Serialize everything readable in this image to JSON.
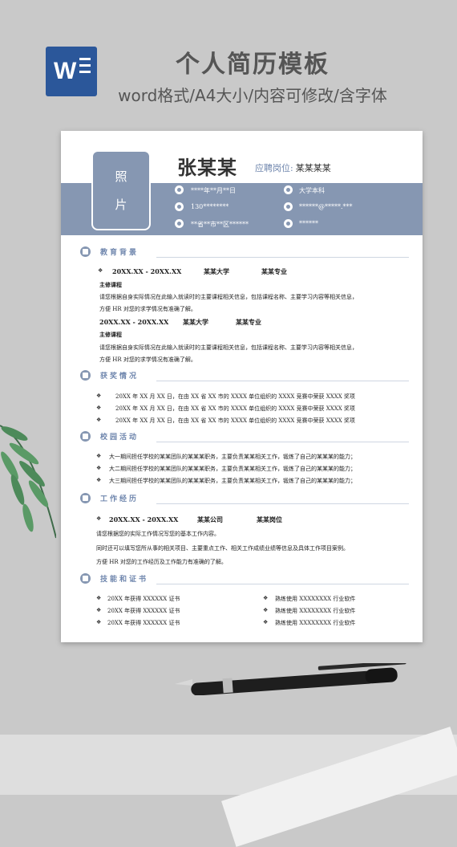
{
  "header": {
    "title": "个人简历模板",
    "subtitle": "word格式/A4大小/内容可修改/含字体"
  },
  "resume": {
    "photo_chars": [
      "照",
      "片"
    ],
    "name": "张某某",
    "apply_label": "应聘岗位:",
    "apply_value": "某某某某",
    "info": {
      "birth": "****年**月**日",
      "education": "大学本科",
      "phone": "130********",
      "email": "******@*****.***",
      "address": "**省**市**区******",
      "other": "******"
    }
  },
  "sections": {
    "education": {
      "title": "教育背景",
      "entries": [
        {
          "period": "20XX.XX - 20XX.XX",
          "school": "某某大学",
          "major": "某某专业",
          "course_label": "主修课程",
          "desc1": "请您根据自身实际情况在此输入就读时的主要课程相关信息，包括课程名称、主要学习内容等相关信息，",
          "desc2": "方便 HR 对您的求学情况有准确了解。"
        },
        {
          "period": "20XX.XX - 20XX.XX",
          "school": "某某大学",
          "major": "某某专业",
          "course_label": "主修课程",
          "desc1": "请您根据自身实际情况在此输入就读时的主要课程相关信息，包括课程名称、主要学习内容等相关信息，",
          "desc2": "方便 HR 对您的求学情况有准确了解。"
        }
      ]
    },
    "awards": {
      "title": "获奖情况",
      "items": [
        "20XX 年 XX 月 XX 日，在由 XX 省 XX 市的 XXXX 单位组织的 XXXX 竞赛中荣获 XXXX 奖项",
        "20XX 年 XX 月 XX 日，在由 XX 省 XX 市的 XXXX 单位组织的 XXXX 竞赛中荣获 XXXX 奖项",
        "20XX 年 XX 月 XX 日，在由 XX 省 XX 市的 XXXX 单位组织的 XXXX 竞赛中荣获 XXXX 奖项"
      ]
    },
    "campus": {
      "title": "校园活动",
      "items": [
        "大一期间担任学校的某某团队的某某某职务，主要负责某某相关工作，锻炼了自己的某某某的能力；",
        "大二期间担任学校的某某团队的某某某职务，主要负责某某相关工作，锻炼了自己的某某某的能力；",
        "大三期间担任学校的某某团队的某某某职务，主要负责某某相关工作，锻炼了自己的某某某的能力；"
      ]
    },
    "work": {
      "title": "工作经历",
      "period": "20XX.XX - 20XX.XX",
      "company": "某某公司",
      "position": "某某岗位",
      "line1": "请您根据您的实际工作情况写您的基本工作内容。",
      "line2": "同时还可以填写您所从事的相关项目、主要重点工作、相关工作成绩业绩等信息及具体工作项目案例。",
      "line3": "方便 HR 对您的工作经历及工作能力有准确的了解。"
    },
    "skills": {
      "title": "技能和证书",
      "left": [
        "20XX 年获得 XXXXXX 证书",
        "20XX 年获得 XXXXXX 证书",
        "20XX 年获得 XXXXXX 证书"
      ],
      "right": [
        "熟练使用 XXXXXXXX 行业软件",
        "熟练使用 XXXXXXXX 行业软件",
        "熟练使用 XXXXXXXX 行业软件"
      ]
    }
  },
  "colors": {
    "accent": "#8697b2",
    "accent_text": "#6f86ad",
    "word_blue": "#2b579a"
  },
  "icons": [
    "word-icon",
    "calendar-icon",
    "graduation-icon",
    "phone-icon",
    "email-icon",
    "location-icon",
    "other-icon"
  ]
}
